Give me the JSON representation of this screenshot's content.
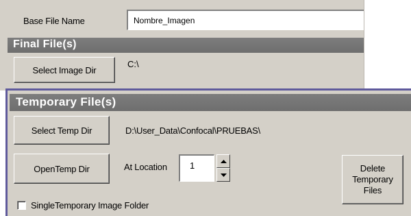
{
  "base_file": {
    "label": "Base File Name",
    "value": "Nombre_Imagen"
  },
  "final_files": {
    "section_title": "Final File(s)",
    "select_button_label": "Select Image Dir",
    "directory": "C:\\"
  },
  "temporary_files": {
    "section_title": "Temporary File(s)",
    "select_button_label": "Select Temp Dir",
    "directory": "D:\\User_Data\\Confocal\\PRUEBAS\\",
    "open_button_label": "OpenTemp Dir",
    "location_label": "At Location",
    "location_value": "1",
    "delete_button_label": "Delete Temporary Files",
    "single_folder_checkbox": {
      "label": "SingleTemporary Image Folder",
      "checked": false
    }
  },
  "colors": {
    "panel_bg": "#d4d0c8",
    "section_bar": "#727272",
    "front_panel_border": "#5f5a9c"
  },
  "icons": {
    "spin_up": "arrow-up-icon",
    "spin_down": "arrow-down-icon"
  }
}
